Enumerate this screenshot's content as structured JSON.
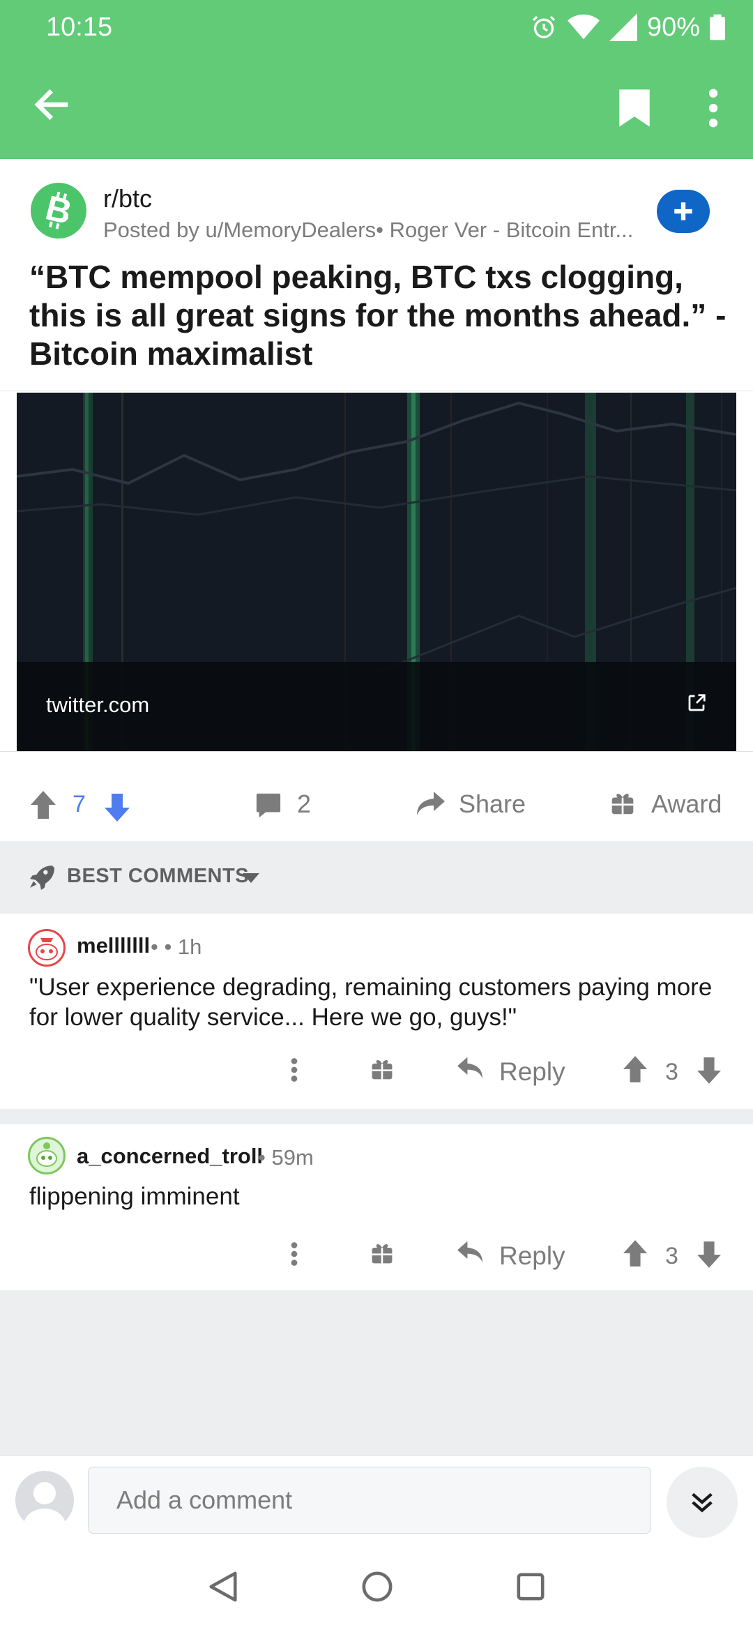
{
  "status_bar": {
    "time": "10:15",
    "battery": "90%"
  },
  "post": {
    "subreddit": "r/btc",
    "posted_by": "Posted by u/MemoryDealers• Roger Ver - Bitcoin Entr...",
    "title": "“BTC mempool peaking, BTC txs clogging, this is all great signs for the months ahead.” - Bitcoin maximalist",
    "link_domain": "twitter.com",
    "score": "7",
    "comment_count": "2",
    "share_label": "Share",
    "award_label": "Award"
  },
  "sort": {
    "label": "BEST COMMENTS"
  },
  "comments": [
    {
      "author": "melllllll",
      "time": "• • 1h",
      "body": "\"User experience degrading, remaining customers paying more for lower quality service... Here we go, guys!\"",
      "reply_label": "Reply",
      "score": "3"
    },
    {
      "author": "a_concerned_troll",
      "time": "• 59m",
      "body": "flippening imminent",
      "reply_label": "Reply",
      "score": "3"
    }
  ],
  "composer": {
    "placeholder": "Add a comment"
  },
  "colors": {
    "app_bar": "#61cb77",
    "upvote_active": "#4f7cf0",
    "join_button": "#0f66c6"
  },
  "icons": [
    "arrow-left-icon",
    "bookmark-icon",
    "more-vertical-icon",
    "bitcoin-icon",
    "plus-icon",
    "upvote-icon",
    "downvote-icon",
    "comment-icon",
    "share-icon",
    "gift-icon",
    "rocket-icon",
    "reply-icon",
    "chevron-double-down-icon"
  ]
}
